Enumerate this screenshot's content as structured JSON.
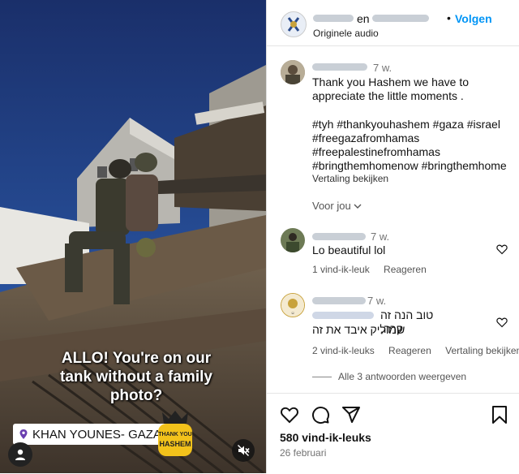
{
  "media": {
    "caption_lines": [
      "ALLO! You're on our",
      "tank without a family",
      "photo?"
    ],
    "location": "KHAN YOUNES- GAZA",
    "badge_lines": [
      "THANK YOU",
      "HASHEM"
    ],
    "icons": [
      "location-pin-icon",
      "user-icon",
      "mute-icon"
    ]
  },
  "header": {
    "joiner": "en",
    "follow": "Volgen",
    "subtitle": "Originele audio"
  },
  "post": {
    "time": "7 w.",
    "text_lines": [
      "Thank you Hashem we have to",
      "appreciate the little moments ."
    ],
    "hashtag_lines": [
      "#tyh #thankyouhashem #gaza #israel",
      "#freegazafromhamas",
      "#freepalestinefromhamas",
      "#bringthemhomenow #bringthemhome"
    ],
    "translate": "Vertaling bekijken",
    "for_you": "Voor jou"
  },
  "comments": [
    {
      "time": "7 w.",
      "text": "Lo beautiful lol",
      "likes": "1 vind-ik-leuk",
      "reply": "Reageren"
    },
    {
      "time": "7 w.",
      "text_line1": "טוב הנה זה קרה,",
      "text_line2": "שמוליק איבד את זה",
      "likes": "2 vind-ik-leuks",
      "reply": "Reageren",
      "translate": "Vertaling bekijken"
    }
  ],
  "view_replies": "Alle 3 antwoorden weergeven",
  "footer": {
    "likes": "580 vind-ik-leuks",
    "date": "26 februari",
    "icons": [
      "heart-icon",
      "comment-icon",
      "share-icon",
      "bookmark-icon"
    ]
  },
  "colors": {
    "link": "#0095f6",
    "sky": "#233f7a",
    "muted": "#737373"
  }
}
